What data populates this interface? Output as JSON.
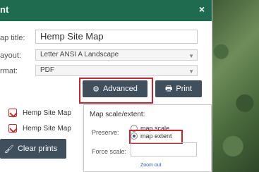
{
  "header": {
    "title": "nt",
    "close_label": "×"
  },
  "form": {
    "map_title": {
      "label": "ap title:",
      "value": "Hemp Site Map"
    },
    "layout": {
      "label": "ayout:",
      "value": "Letter ANSI A Landscape"
    },
    "format": {
      "label": "rmat:",
      "value": "PDF"
    }
  },
  "buttons": {
    "advanced": "Advanced",
    "print": "Print",
    "clear_prints": "Clear prints"
  },
  "prints": [
    {
      "label": "Hemp Site Map"
    },
    {
      "label": "Hemp Site Map"
    }
  ],
  "popup": {
    "heading": "Map scale/extent:",
    "preserve_label": "Preserve:",
    "option_scale": "map scale",
    "option_extent": "map extent",
    "force_scale_label": "Force scale:",
    "link_text": "Zoom out"
  },
  "colors": {
    "header": "#1f6b4f",
    "button": "#3f4f5c",
    "highlight": "#d21f2b",
    "link": "#2f57b7"
  },
  "icons": {
    "close": "close-icon",
    "gear": "gear-icon",
    "printer": "printer-icon",
    "pdf": "pdf-icon",
    "brush": "brush-icon",
    "dropdown": "chevron-down-icon"
  }
}
